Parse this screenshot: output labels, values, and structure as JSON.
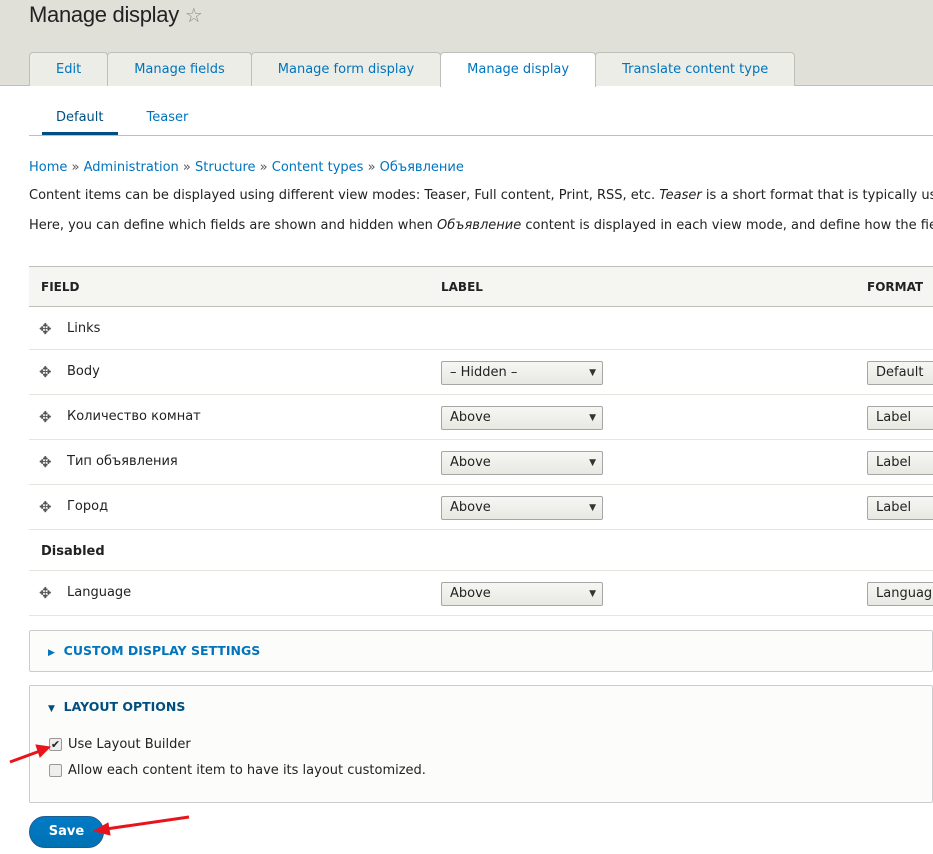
{
  "page": {
    "title": "Manage display",
    "star_icon": "star-outline-icon"
  },
  "tabs": [
    {
      "label": "Edit"
    },
    {
      "label": "Manage fields"
    },
    {
      "label": "Manage form display"
    },
    {
      "label": "Manage display",
      "active": true
    },
    {
      "label": "Translate content type"
    }
  ],
  "subtabs": [
    {
      "label": "Default",
      "active": true
    },
    {
      "label": "Teaser"
    }
  ],
  "breadcrumb": [
    "Home",
    "Administration",
    "Structure",
    "Content types",
    "Объявление"
  ],
  "breadcrumb_sep": "»",
  "intro": {
    "p1_a": "Content items can be displayed using different view modes: Teaser, Full content, Print, RSS, etc. ",
    "p1_em": "Teaser",
    "p1_b": " is a short format that is typically used i",
    "p2_a": "Here, you can define which fields are shown and hidden when ",
    "p2_em": "Объявление",
    "p2_b": " content is displayed in each view mode, and define how the fields ar"
  },
  "table": {
    "headers": {
      "field": "FIELD",
      "label": "LABEL",
      "format": "FORMAT"
    },
    "rows": [
      {
        "name": "Links"
      },
      {
        "name": "Body",
        "label": "– Hidden –",
        "format": "Default"
      },
      {
        "name": "Количество комнат",
        "label": "Above",
        "format": "Label"
      },
      {
        "name": "Тип объявления",
        "label": "Above",
        "format": "Label"
      },
      {
        "name": "Город",
        "label": "Above",
        "format": "Label"
      }
    ],
    "disabled_region": "Disabled",
    "disabled_rows": [
      {
        "name": "Language",
        "label": "Above",
        "format": "Languag"
      }
    ]
  },
  "custom_display": {
    "label": "CUSTOM DISPLAY SETTINGS",
    "expanded": false
  },
  "layout_options": {
    "label": "LAYOUT OPTIONS",
    "expanded": true,
    "use_layout_builder": {
      "label": "Use Layout Builder",
      "checked": true
    },
    "allow_custom": {
      "label": "Allow each content item to have its layout customized.",
      "checked": false
    }
  },
  "save_label": "Save",
  "colors": {
    "link": "#0074bd",
    "primary_button": "#0071b8",
    "annotation_arrow": "#e8141b"
  }
}
